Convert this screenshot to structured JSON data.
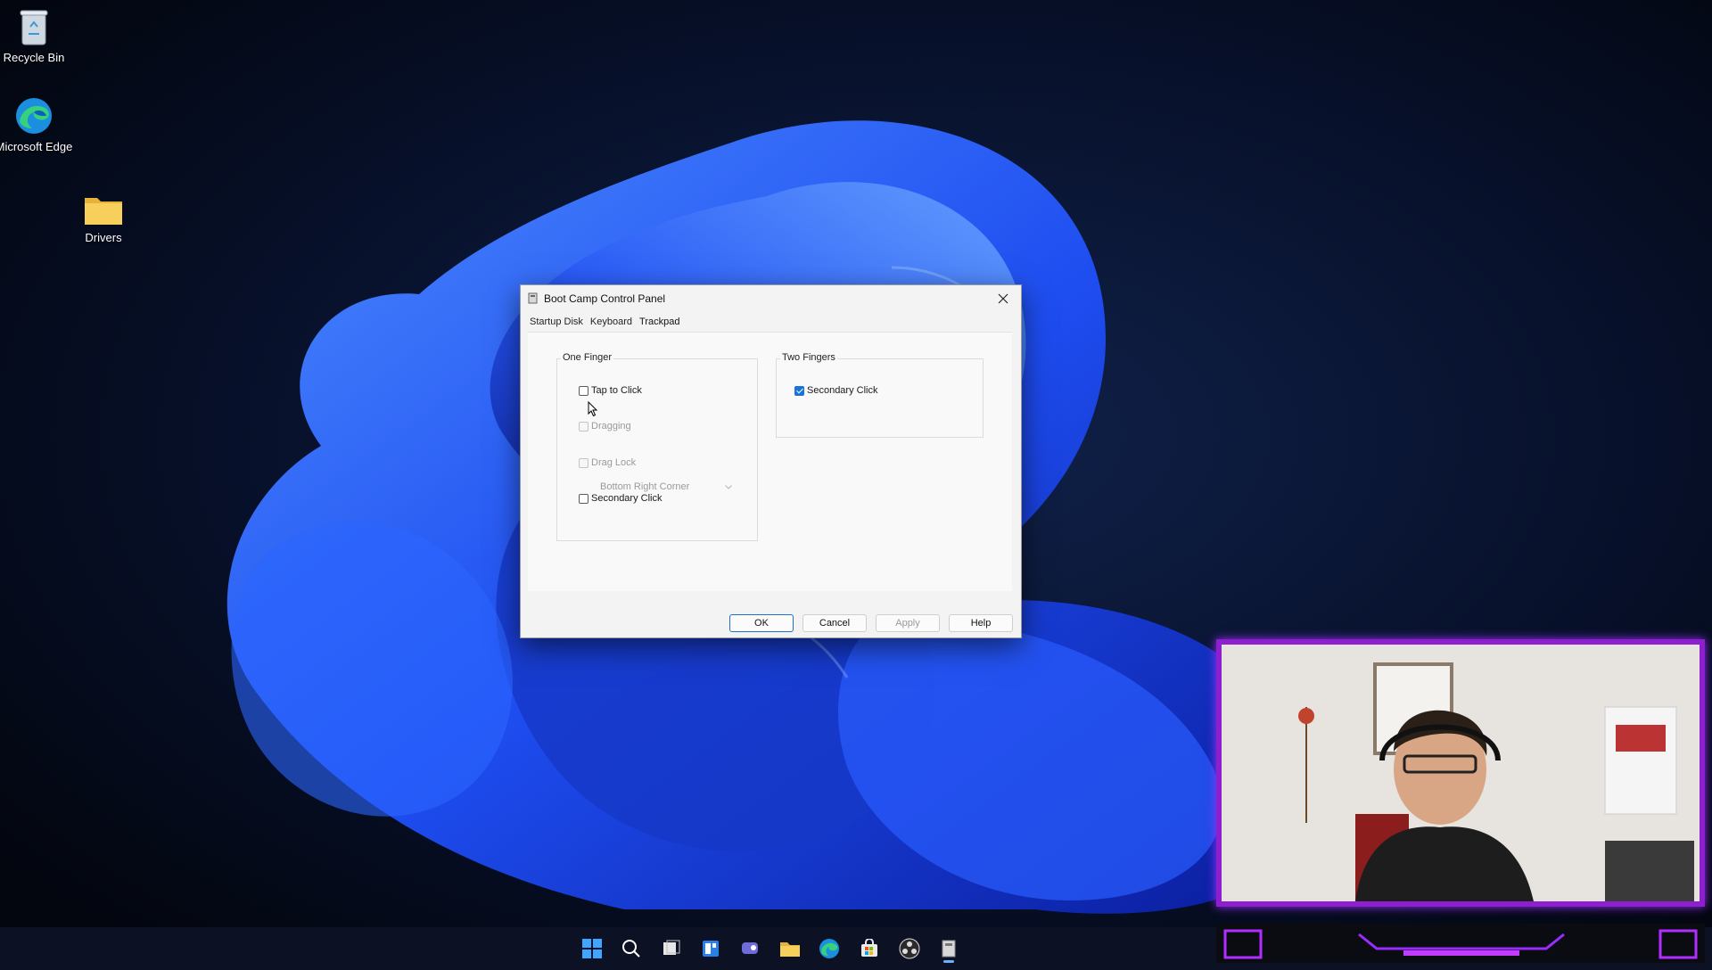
{
  "desktop": {
    "icons": [
      {
        "label": "Recycle Bin",
        "icon": "recycle-bin-icon"
      },
      {
        "label": "Microsoft Edge",
        "icon": "edge-icon"
      },
      {
        "label": "Drivers",
        "icon": "folder-icon"
      }
    ]
  },
  "dialog": {
    "title": "Boot Camp Control Panel",
    "tabs": [
      "Startup Disk",
      "Keyboard",
      "Trackpad"
    ],
    "active_tab": "Trackpad",
    "one_finger": {
      "title": "One Finger",
      "options": [
        {
          "label": "Tap to Click",
          "checked": false,
          "enabled": true
        },
        {
          "label": "Dragging",
          "checked": false,
          "enabled": false
        },
        {
          "label": "Drag Lock",
          "checked": false,
          "enabled": false
        },
        {
          "label": "Secondary Click",
          "checked": false,
          "enabled": true
        }
      ],
      "secondary_click_position": "Bottom Right Corner"
    },
    "two_fingers": {
      "title": "Two Fingers",
      "options": [
        {
          "label": "Secondary Click",
          "checked": true,
          "enabled": true
        }
      ]
    },
    "buttons": {
      "ok": "OK",
      "cancel": "Cancel",
      "apply": "Apply",
      "help": "Help"
    }
  },
  "taskbar": {
    "icons": [
      "windows-start-icon",
      "search-icon",
      "task-view-icon",
      "widgets-icon",
      "teams-chat-icon",
      "file-explorer-icon",
      "edge-icon",
      "store-icon",
      "obs-icon",
      "bootcamp-icon"
    ]
  },
  "colors": {
    "accent": "#1a73d6",
    "wallpaper_blue": "#1f4ff5",
    "cam_frame": "#8d1fcf"
  }
}
